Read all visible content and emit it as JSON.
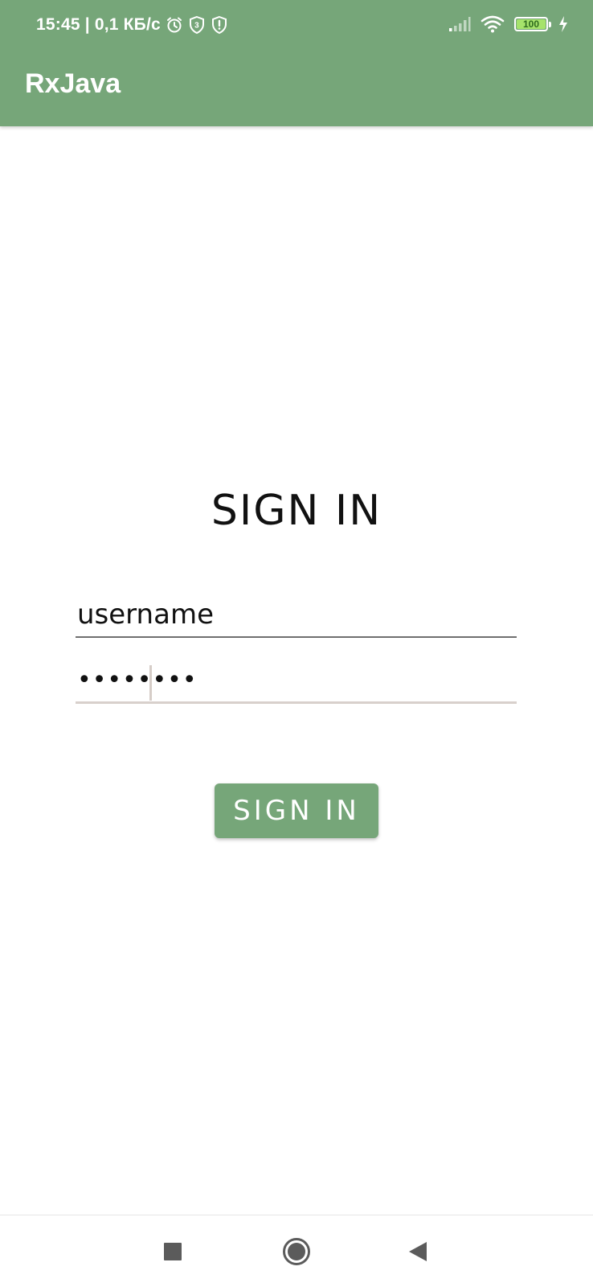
{
  "theme": {
    "primary": "#76a679",
    "battery_fill": "#a6e36b"
  },
  "status_bar": {
    "time": "15:45",
    "network_speed": "| 0,1 КБ/с",
    "left_icons": [
      "alarm-icon",
      "shield-3-icon",
      "shield-alert-icon"
    ],
    "right_icons": [
      "signal-icon",
      "wifi-icon",
      "battery-icon",
      "charging-icon"
    ],
    "battery_level": "100",
    "battery_fraction": 1.0
  },
  "app_bar": {
    "title": "RxJava"
  },
  "form": {
    "heading": "SIGN IN",
    "username": {
      "placeholder": "username",
      "value": ""
    },
    "password": {
      "value": "••••••••"
    },
    "submit_label": "SIGN IN"
  },
  "nav_bar": {
    "buttons": [
      "recents-icon",
      "home-icon",
      "back-icon"
    ]
  }
}
